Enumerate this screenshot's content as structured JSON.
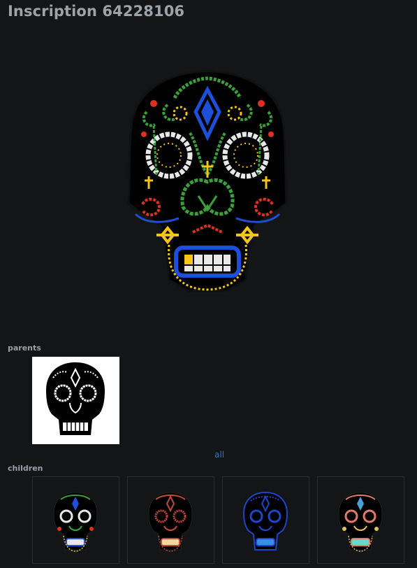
{
  "header": {
    "title": "Inscription 64228106"
  },
  "inscription": {
    "art_icon": "sugar-skull-pixel-art",
    "palette": {
      "gold": "#f5c518",
      "green": "#3aa13a",
      "blue": "#1e4fd8",
      "red": "#e03020",
      "white": "#e8e8e8"
    }
  },
  "parents": {
    "label": "parents",
    "items": [
      {
        "icon": "sugar-skull-white-outline"
      }
    ]
  },
  "children": {
    "label": "children",
    "all_link": "all",
    "items": [
      {
        "icon": "sugar-skull-multicolor",
        "accent": "#3aa13a"
      },
      {
        "icon": "sugar-skull-red",
        "accent": "#c04a3a"
      },
      {
        "icon": "sugar-skull-blue",
        "accent": "#1d46c8"
      },
      {
        "icon": "sugar-skull-pastel",
        "accent": "#e07a6a"
      }
    ]
  }
}
